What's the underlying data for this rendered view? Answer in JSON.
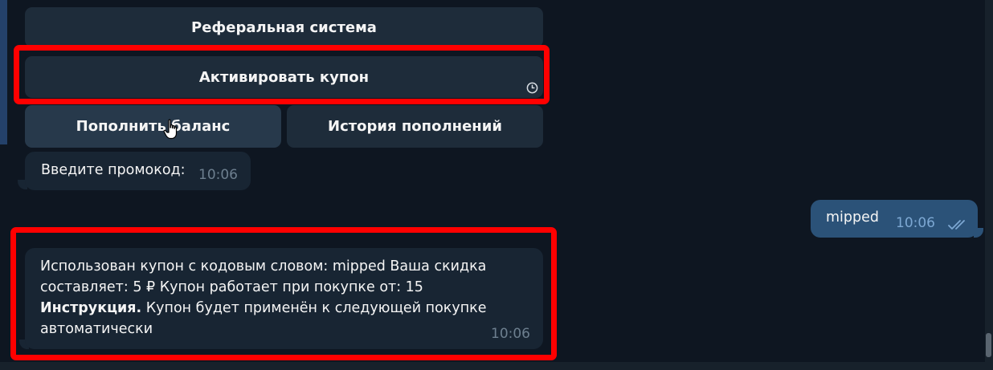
{
  "keyboard": {
    "referral_label": "Реферальная система",
    "activate_coupon_label": "Активировать купон",
    "top_up_label": "Пополнить баланс",
    "history_label": "История пополнений"
  },
  "messages": {
    "prompt": {
      "text": "Введите промокод:",
      "time": "10:06"
    },
    "outgoing": {
      "text": "mipped",
      "time": "10:06"
    },
    "result": {
      "line1": "Использован купон с кодовым словом: mipped Ваша скидка",
      "line2": "составляет: 5 ₽ Купон работает при покупке от: 15",
      "instruction_label": "Инструкция.",
      "line3_rest": " Купон будет применён к следующей покупке",
      "line4": "автоматически",
      "time": "10:06"
    }
  },
  "colors": {
    "background": "#0e1621",
    "bubble_in": "#182533",
    "bubble_out": "#2b5278",
    "keyboard_button": "#1e2c3a",
    "highlight": "#ff0000"
  },
  "icons": [
    "clock-icon",
    "double-check-icon",
    "hand-cursor-icon"
  ]
}
